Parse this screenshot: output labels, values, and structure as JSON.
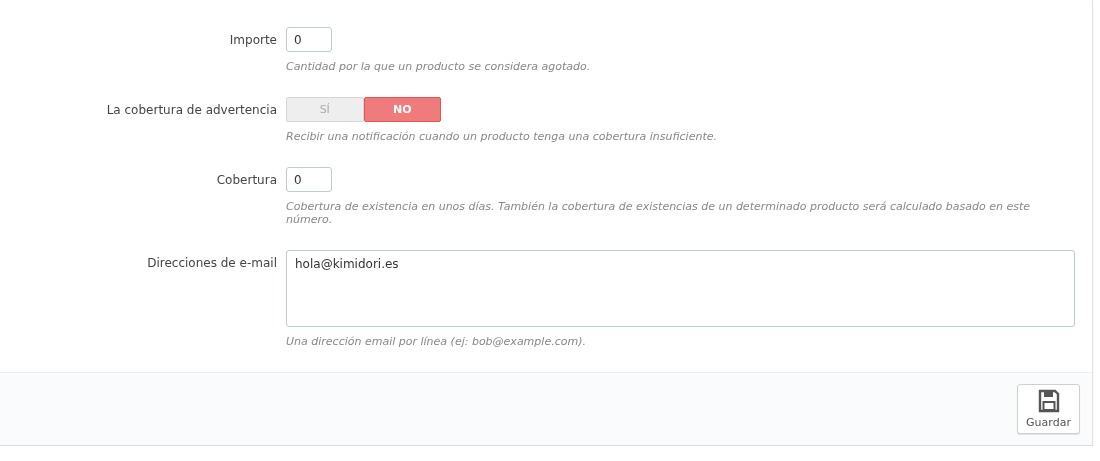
{
  "fields": [
    {
      "kind": "input",
      "label": "Importe",
      "value": "0",
      "help": "Cantidad por la que un producto se considera agotado."
    },
    {
      "kind": "switch",
      "label": "La cobertura de advertencia",
      "options": [
        {
          "label": "SÍ",
          "selected": false
        },
        {
          "label": "NO",
          "selected": true
        }
      ],
      "help": "Recibir una notificación cuando un producto tenga una cobertura insuficiente."
    },
    {
      "kind": "input",
      "label": "Cobertura",
      "value": "0",
      "help": "Cobertura de existencia en unos días. También la cobertura de existencias de un determinado producto será calculado basado en este número."
    },
    {
      "kind": "textarea",
      "label": "Direcciones de e-mail",
      "value": "hola@kimidori.es",
      "help": "Una dirección email por línea (ej: bob@example.com)."
    }
  ],
  "footer": {
    "save_button": "Guardar"
  }
}
